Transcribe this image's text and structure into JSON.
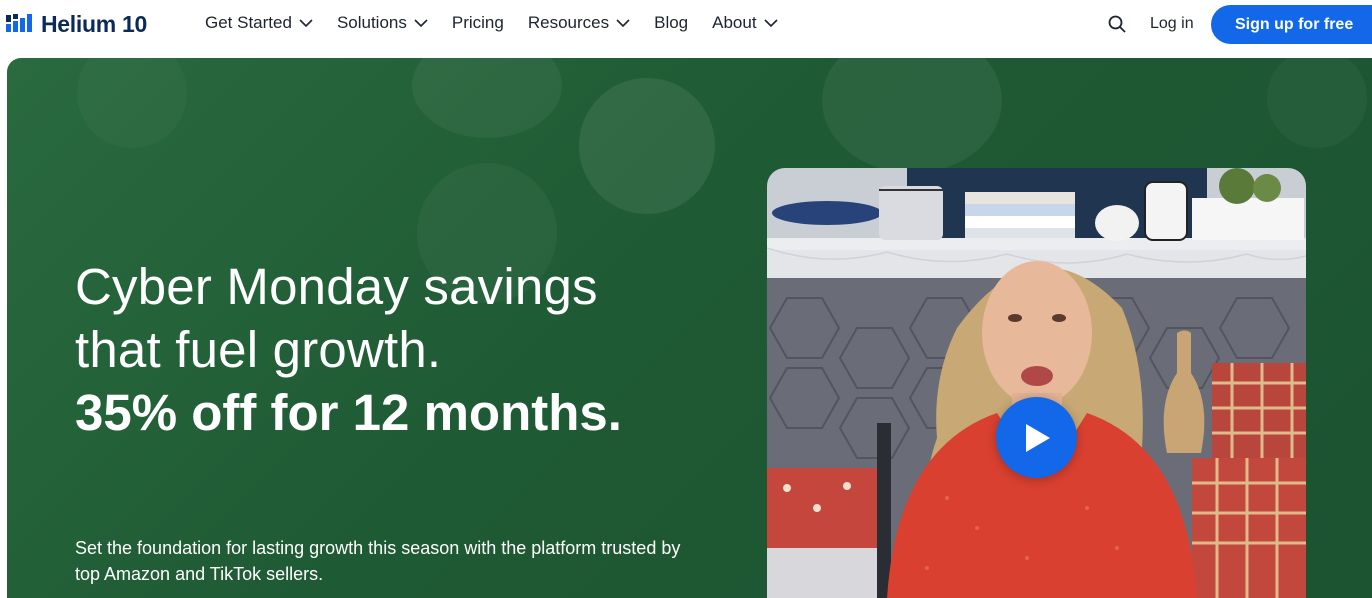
{
  "brand": {
    "name": "Helium 10",
    "color": "#0b2a5a",
    "accent": "#1268e8"
  },
  "nav": {
    "items": [
      {
        "label": "Get Started",
        "has_dropdown": true
      },
      {
        "label": "Solutions",
        "has_dropdown": true
      },
      {
        "label": "Pricing",
        "has_dropdown": false
      },
      {
        "label": "Resources",
        "has_dropdown": true
      },
      {
        "label": "Blog",
        "has_dropdown": false
      },
      {
        "label": "About",
        "has_dropdown": true
      }
    ],
    "search_icon": "search-icon",
    "login_label": "Log in",
    "signup_label": "Sign up for free"
  },
  "hero": {
    "background_color": "#1f5c36",
    "headline_regular": "Cyber Monday savings that fuel growth.",
    "headline_bold": "35% off for 12 months.",
    "subtext": "Set the foundation for lasting growth this season with the platform trusted by top Amazon and TikTok sellers.",
    "video": {
      "play_icon": "play-icon",
      "play_color": "#1268e8"
    }
  }
}
